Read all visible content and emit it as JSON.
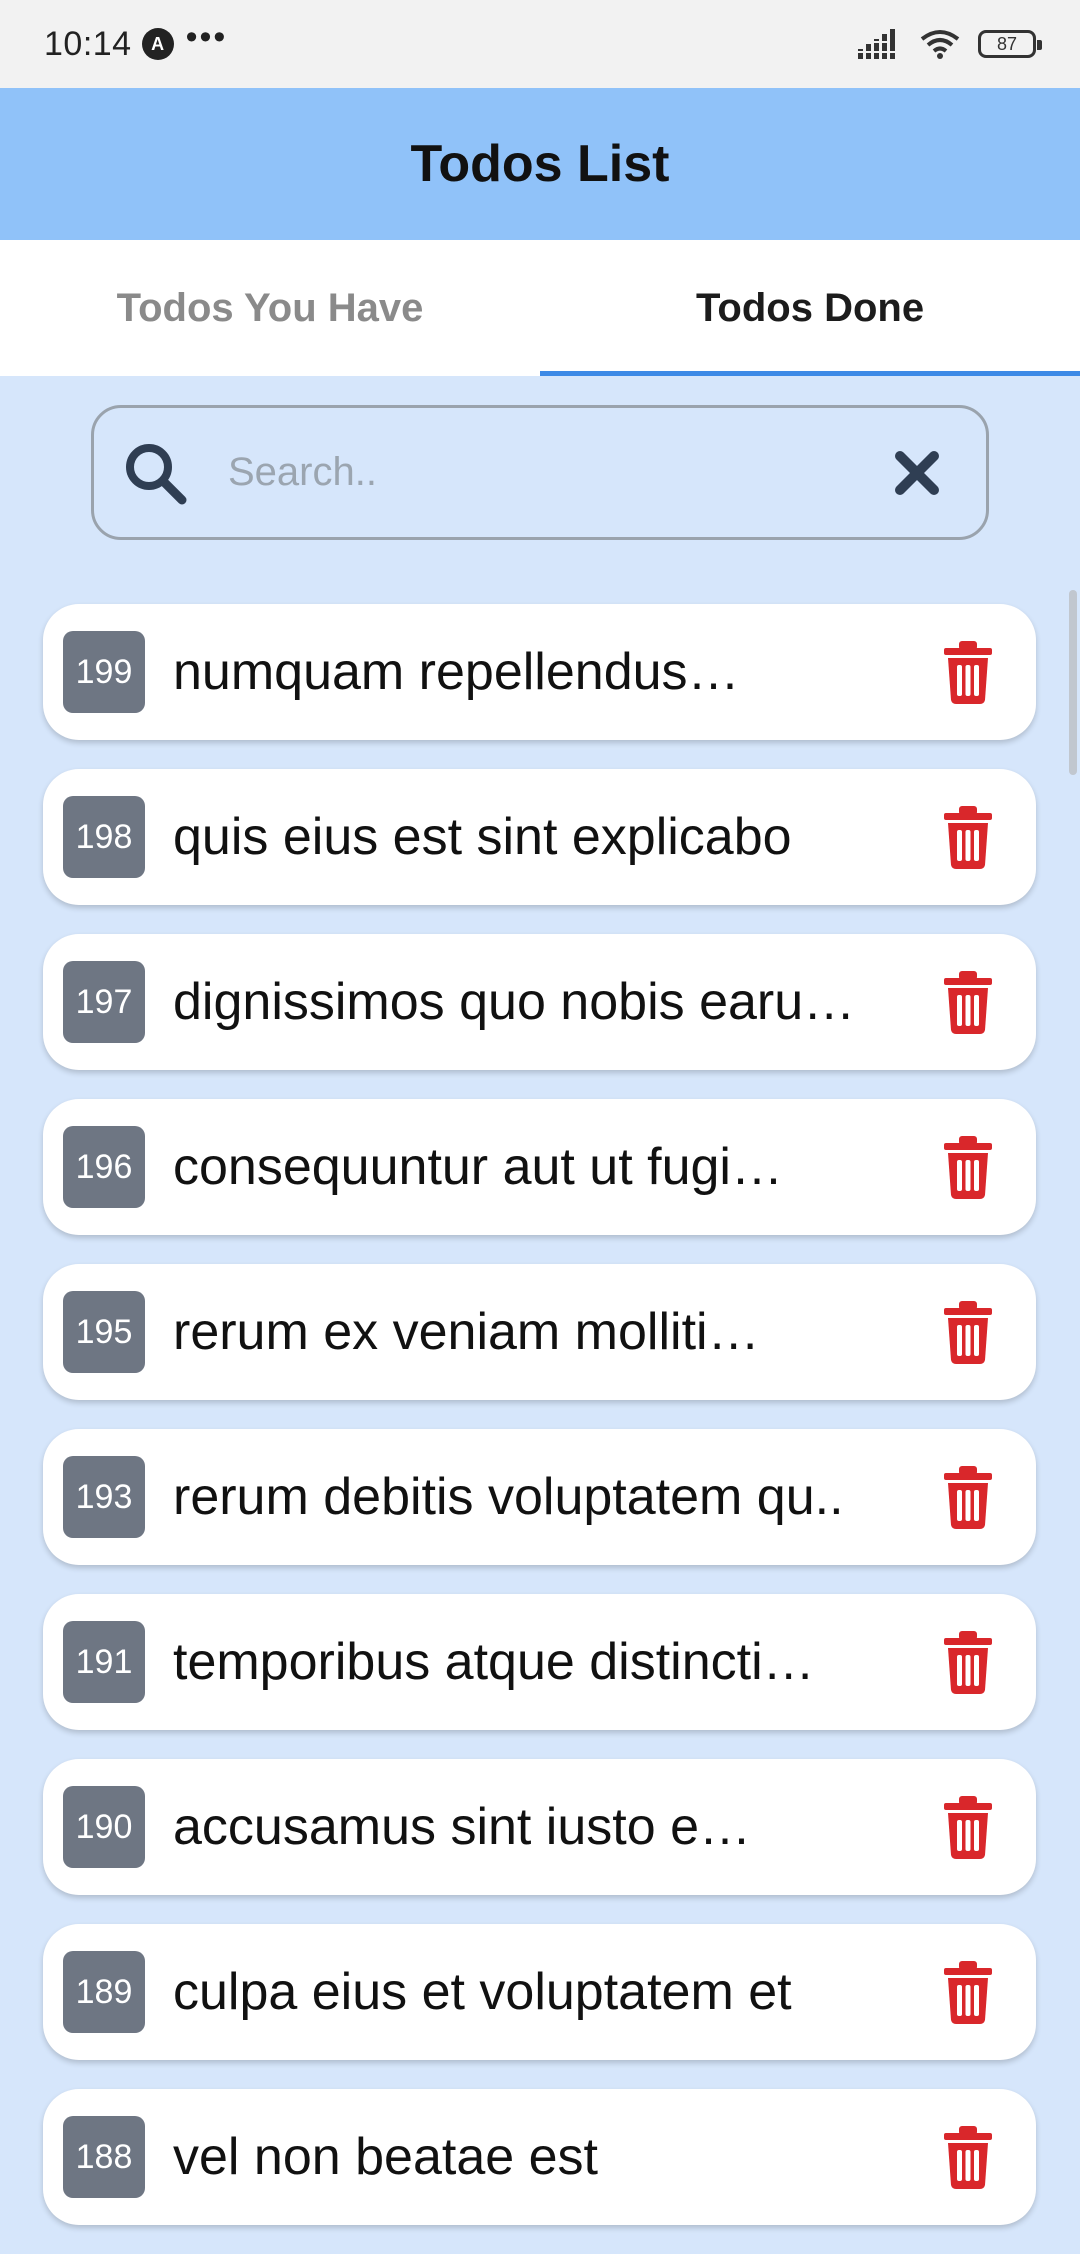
{
  "status_bar": {
    "time": "10:14",
    "notification_letter": "A",
    "more": "•••",
    "battery": "87"
  },
  "header": {
    "title": "Todos List"
  },
  "tabs": [
    {
      "label": "Todos You Have",
      "active": false
    },
    {
      "label": "Todos Done",
      "active": true
    }
  ],
  "search": {
    "placeholder": "Search..",
    "value": ""
  },
  "colors": {
    "header_bg": "#90c2f9",
    "page_bg": "#d6e6fb",
    "tab_indicator": "#3d8ae6",
    "id_badge": "#6e7683",
    "delete_icon": "#d9272b"
  },
  "todos": [
    {
      "id": "199",
      "title": "numquam repellendus…"
    },
    {
      "id": "198",
      "title": "quis eius est sint explicabo"
    },
    {
      "id": "197",
      "title": "dignissimos quo nobis earu…"
    },
    {
      "id": "196",
      "title": "consequuntur aut ut fugi…"
    },
    {
      "id": "195",
      "title": "rerum ex veniam molliti…"
    },
    {
      "id": "193",
      "title": "rerum debitis voluptatem qu.."
    },
    {
      "id": "191",
      "title": "temporibus atque distincti…"
    },
    {
      "id": "190",
      "title": "accusamus sint iusto e…"
    },
    {
      "id": "189",
      "title": "culpa eius et voluptatem et"
    },
    {
      "id": "188",
      "title": "vel non beatae est"
    }
  ]
}
